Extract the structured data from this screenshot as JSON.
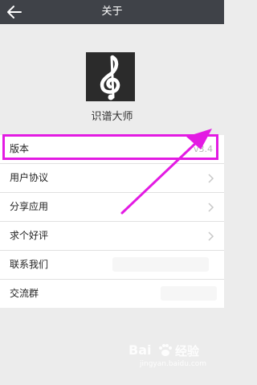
{
  "header": {
    "title": "关于"
  },
  "app": {
    "name": "识谱大师"
  },
  "menu": [
    {
      "label": "版本",
      "value": "v3.4"
    },
    {
      "label": "用户协议"
    },
    {
      "label": "分享应用"
    },
    {
      "label": "求个好评"
    },
    {
      "label": "联系我们"
    },
    {
      "label": "交流群"
    }
  ],
  "watermark": {
    "brand": "Bai",
    "brand2": "经验",
    "url": "jingyan.baidu.com"
  },
  "colors": {
    "topbar": "#3f4248",
    "highlight": "#e31be3",
    "background": "#ececec"
  }
}
